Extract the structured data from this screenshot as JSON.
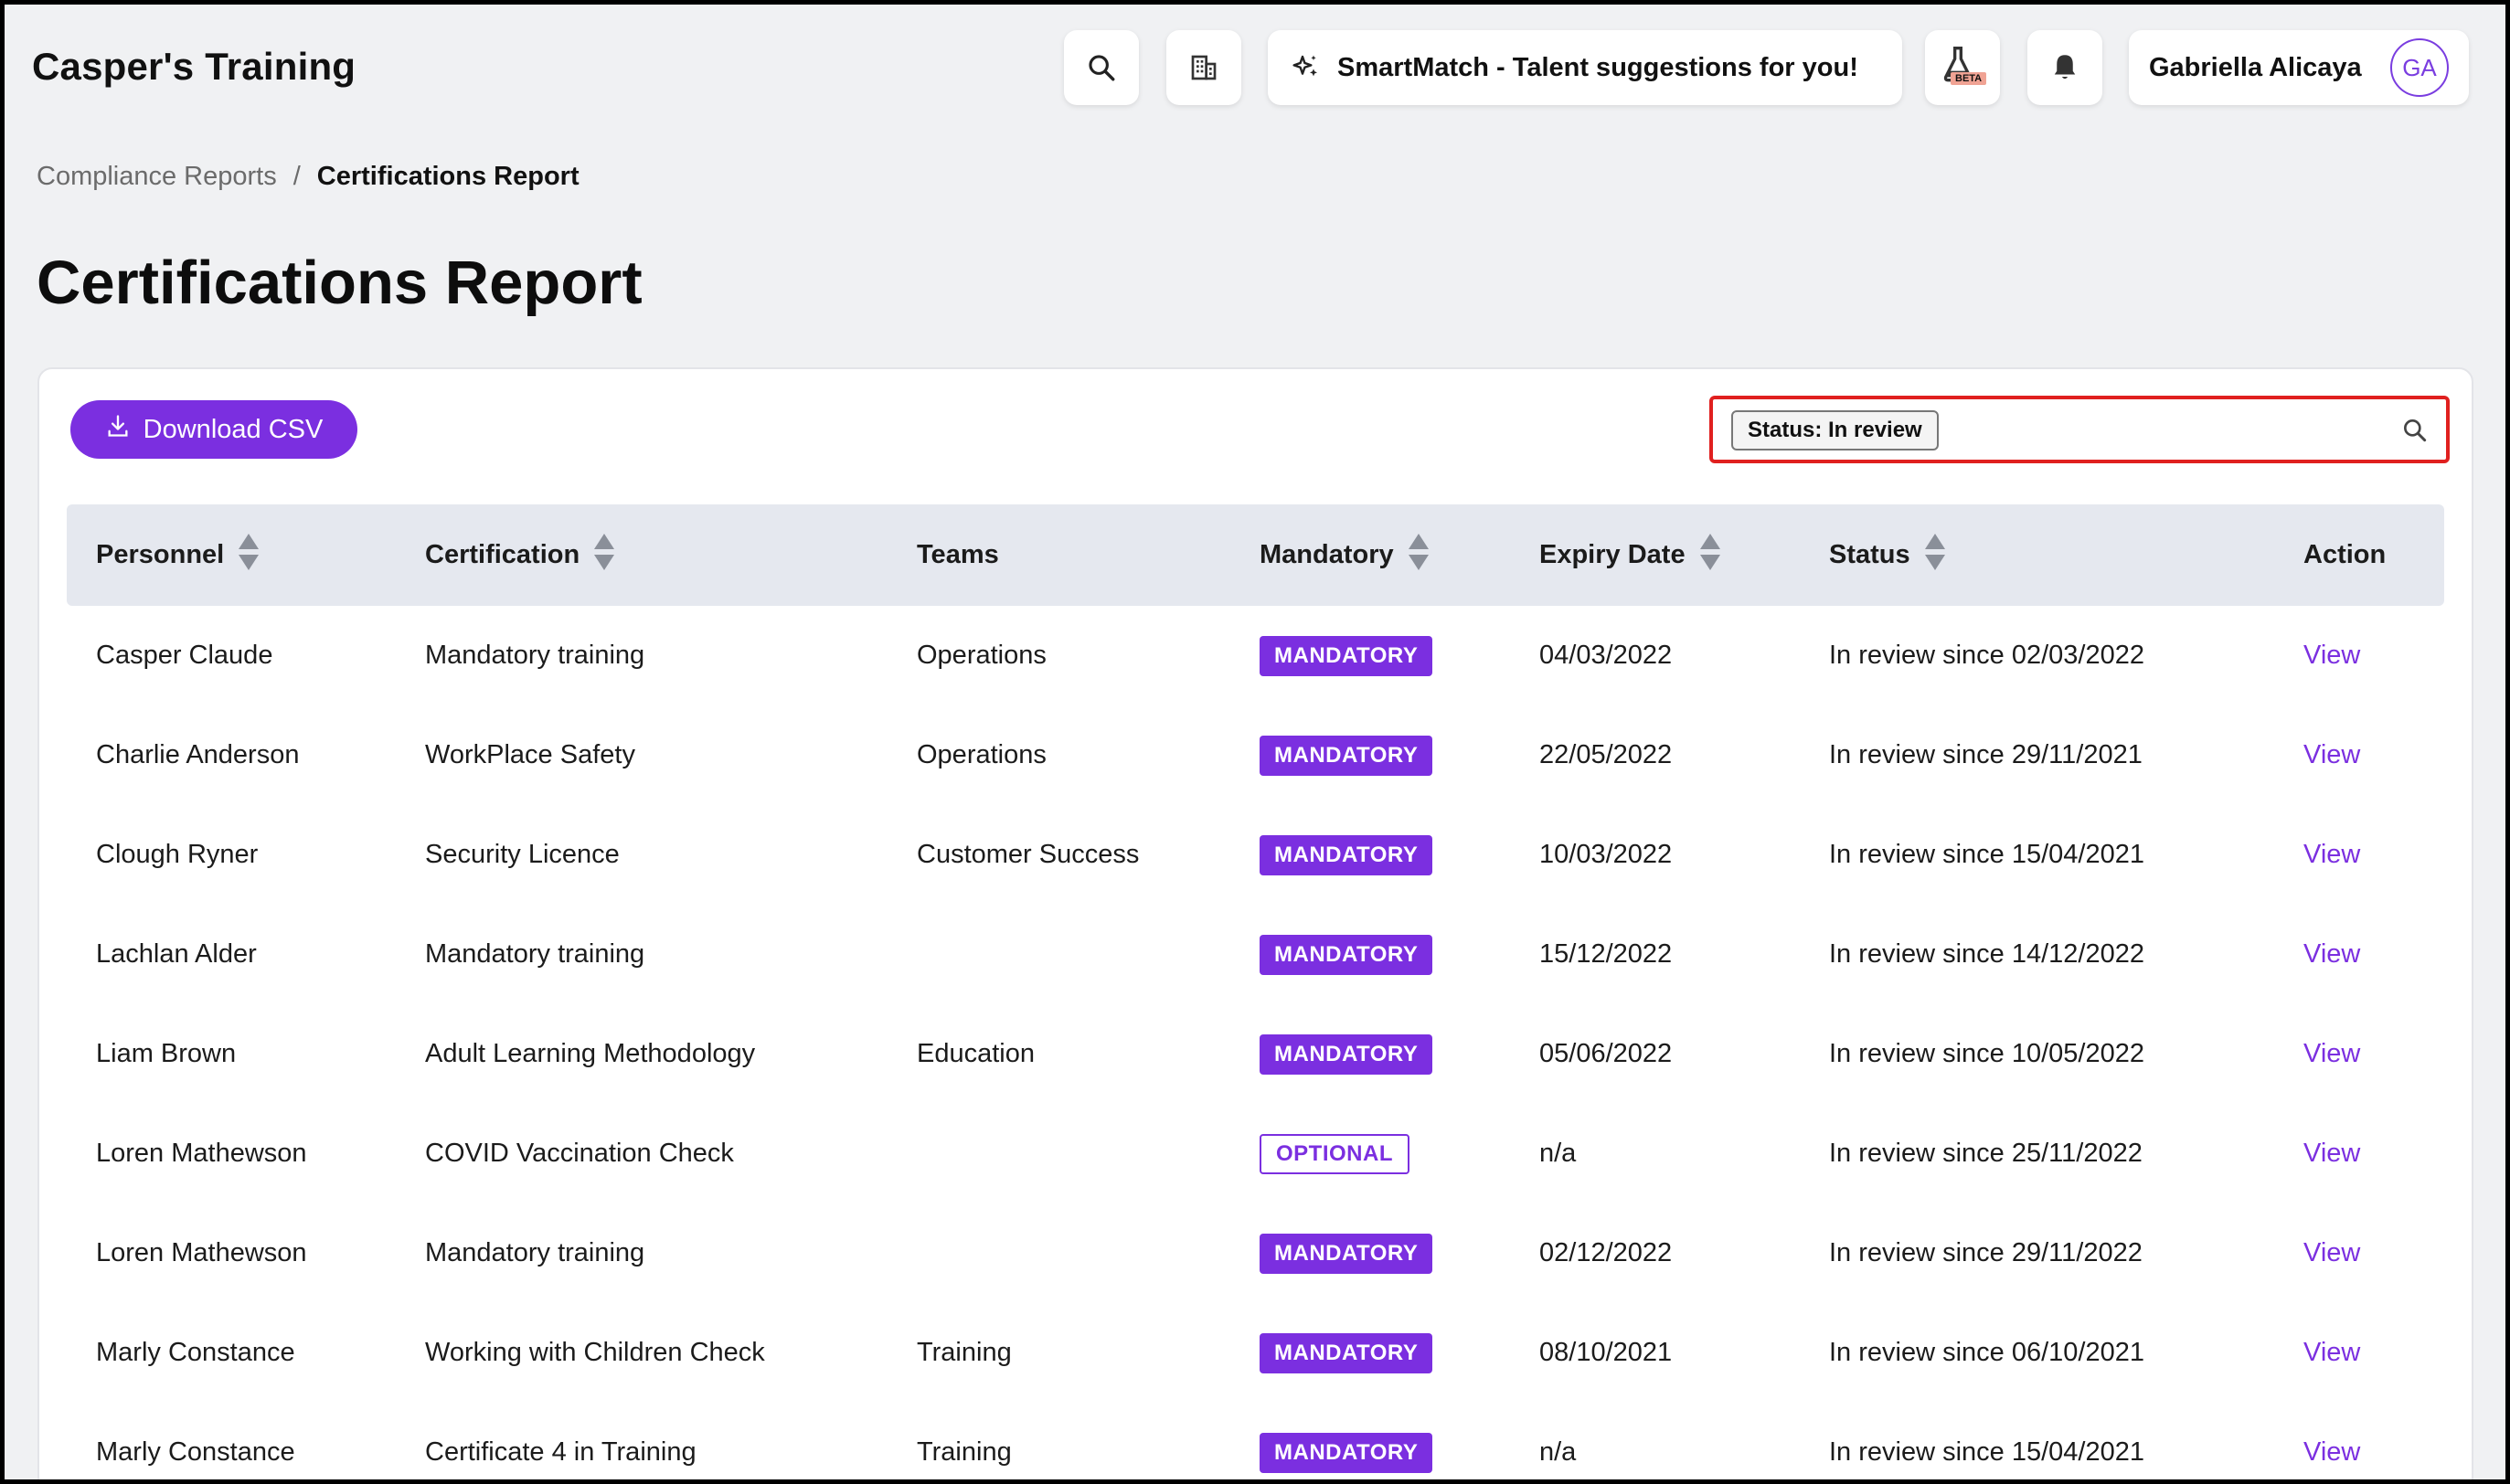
{
  "app": {
    "title": "Casper's Training"
  },
  "topbar": {
    "smartmatch_label": "SmartMatch - Talent suggestions for you!",
    "beta_label": "BETA",
    "user_name": "Gabriella Alicaya",
    "user_initials": "GA",
    "icons": [
      "search-icon",
      "building-icon",
      "sparkle-icon",
      "flask-icon",
      "bell-icon"
    ]
  },
  "breadcrumb": {
    "parent": "Compliance Reports",
    "separator": "/",
    "current": "Certifications Report"
  },
  "page": {
    "title": "Certifications Report"
  },
  "toolbar": {
    "download_label": "Download CSV",
    "filter_chip": "Status: In review"
  },
  "table": {
    "headers": {
      "personnel": "Personnel",
      "certification": "Certification",
      "teams": "Teams",
      "mandatory": "Mandatory",
      "expiry": "Expiry Date",
      "status": "Status",
      "action": "Action"
    },
    "rows": [
      {
        "personnel": "Casper Claude",
        "certification": "Mandatory training",
        "teams": "Operations",
        "mandatory": "MANDATORY",
        "expiry": "04/03/2022",
        "status": "In review since 02/03/2022",
        "action": "View"
      },
      {
        "personnel": "Charlie Anderson",
        "certification": "WorkPlace Safety",
        "teams": "Operations",
        "mandatory": "MANDATORY",
        "expiry": "22/05/2022",
        "status": "In review since 29/11/2021",
        "action": "View"
      },
      {
        "personnel": "Clough Ryner",
        "certification": "Security Licence",
        "teams": "Customer Success",
        "mandatory": "MANDATORY",
        "expiry": "10/03/2022",
        "status": "In review since 15/04/2021",
        "action": "View"
      },
      {
        "personnel": "Lachlan Alder",
        "certification": "Mandatory training",
        "teams": "",
        "mandatory": "MANDATORY",
        "expiry": "15/12/2022",
        "status": "In review since 14/12/2022",
        "action": "View"
      },
      {
        "personnel": "Liam Brown",
        "certification": "Adult Learning Methodology",
        "teams": "Education",
        "mandatory": "MANDATORY",
        "expiry": "05/06/2022",
        "status": "In review since 10/05/2022",
        "action": "View"
      },
      {
        "personnel": "Loren Mathewson",
        "certification": "COVID Vaccination Check",
        "teams": "",
        "mandatory": "OPTIONAL",
        "expiry": "n/a",
        "status": "In review since 25/11/2022",
        "action": "View"
      },
      {
        "personnel": "Loren Mathewson",
        "certification": "Mandatory training",
        "teams": "",
        "mandatory": "MANDATORY",
        "expiry": "02/12/2022",
        "status": "In review since 29/11/2022",
        "action": "View"
      },
      {
        "personnel": "Marly Constance",
        "certification": "Working with Children Check",
        "teams": "Training",
        "mandatory": "MANDATORY",
        "expiry": "08/10/2021",
        "status": "In review since 06/10/2021",
        "action": "View"
      },
      {
        "personnel": "Marly Constance",
        "certification": "Certificate 4 in Training",
        "teams": "Training",
        "mandatory": "MANDATORY",
        "expiry": "n/a",
        "status": "In review since 15/04/2021",
        "action": "View"
      }
    ]
  },
  "colors": {
    "accent": "#7b2fe0",
    "page_bg": "#f0f1f3",
    "header_row_bg": "#e5e8ef",
    "highlight_border": "#e0201f"
  }
}
